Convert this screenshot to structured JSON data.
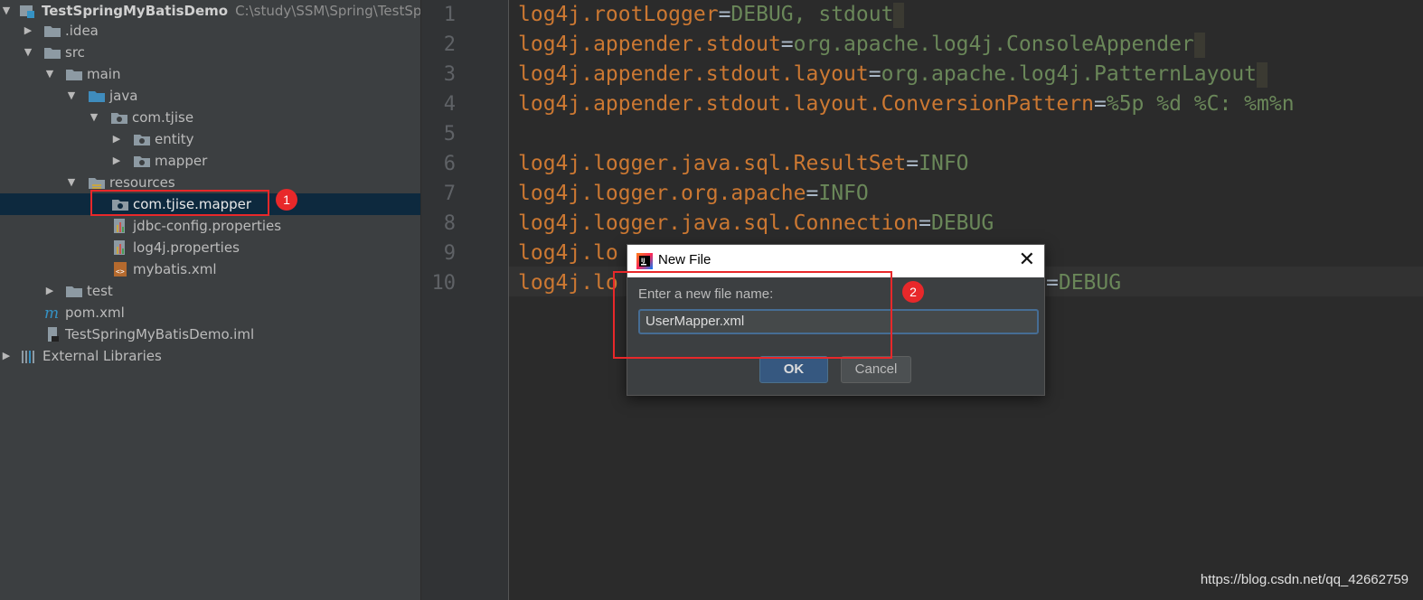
{
  "project_tree": {
    "items": [
      {
        "label": "TestSpringMyBatisDemo",
        "path": "C:\\study\\SSM\\Spring\\TestSprin",
        "icon": "project-module-icon",
        "expanded": true
      },
      {
        "label": ".idea",
        "icon": "folder-icon",
        "expanded": false
      },
      {
        "label": "src",
        "icon": "folder-icon",
        "expanded": true
      },
      {
        "label": "main",
        "icon": "folder-icon",
        "expanded": true
      },
      {
        "label": "java",
        "icon": "source-folder-icon",
        "expanded": true
      },
      {
        "label": "com.tjise",
        "icon": "package-icon",
        "expanded": true
      },
      {
        "label": "entity",
        "icon": "package-icon",
        "expanded": false
      },
      {
        "label": "mapper",
        "icon": "package-icon",
        "expanded": false
      },
      {
        "label": "resources",
        "icon": "resources-folder-icon",
        "expanded": true
      },
      {
        "label": "com.tjise.mapper",
        "icon": "package-icon",
        "selected": true
      },
      {
        "label": "jdbc-config.properties",
        "icon": "properties-file-icon"
      },
      {
        "label": "log4j.properties",
        "icon": "properties-file-icon"
      },
      {
        "label": "mybatis.xml",
        "icon": "xml-file-icon"
      },
      {
        "label": "test",
        "icon": "folder-icon",
        "expanded": false
      },
      {
        "label": "pom.xml",
        "icon": "maven-icon"
      },
      {
        "label": "TestSpringMyBatisDemo.iml",
        "icon": "iml-file-icon"
      },
      {
        "label": "External Libraries",
        "icon": "libraries-icon",
        "expanded": false
      }
    ]
  },
  "editor": {
    "line_numbers": [
      "1",
      "2",
      "3",
      "4",
      "5",
      "6",
      "7",
      "8",
      "9",
      "10"
    ],
    "lines": [
      {
        "key": "log4j.rootLogger",
        "eq": "=",
        "value": "DEBUG, stdout"
      },
      {
        "key": "log4j.appender.stdout",
        "eq": "=",
        "value": "org.apache.log4j.ConsoleAppender"
      },
      {
        "key": "log4j.appender.stdout.layout",
        "eq": "=",
        "value": "org.apache.log4j.PatternLayout"
      },
      {
        "key": "log4j.appender.stdout.layout.ConversionPattern",
        "eq": "=",
        "value": "%5p %d %C: %m%n"
      },
      {
        "key": "",
        "eq": "",
        "value": ""
      },
      {
        "key": "log4j.logger.java.sql.ResultSet",
        "eq": "=",
        "value": "INFO"
      },
      {
        "key": "log4j.logger.org.apache",
        "eq": "=",
        "value": "INFO"
      },
      {
        "key": "log4j.logger.java.sql.Connection",
        "eq": "=",
        "value": "DEBUG"
      },
      {
        "key": "log4j.lo",
        "eq": "",
        "value": ""
      },
      {
        "key": "log4j.lo",
        "eq": "=",
        "value": "DEBUG"
      }
    ]
  },
  "dialog": {
    "title": "New File",
    "prompt": "Enter a new file name:",
    "input_value": "UserMapper.xml",
    "ok_label": "OK",
    "cancel_label": "Cancel"
  },
  "annotations": {
    "badge_1": "1",
    "badge_2": "2"
  },
  "watermark": "https://blog.csdn.net/qq_42662759",
  "colors": {
    "tree_bg": "#3c3f41",
    "editor_bg": "#2b2b2b",
    "key": "#cc7832",
    "value": "#6a8759",
    "selection": "#0d293e",
    "annotation_red": "#e8282a"
  }
}
